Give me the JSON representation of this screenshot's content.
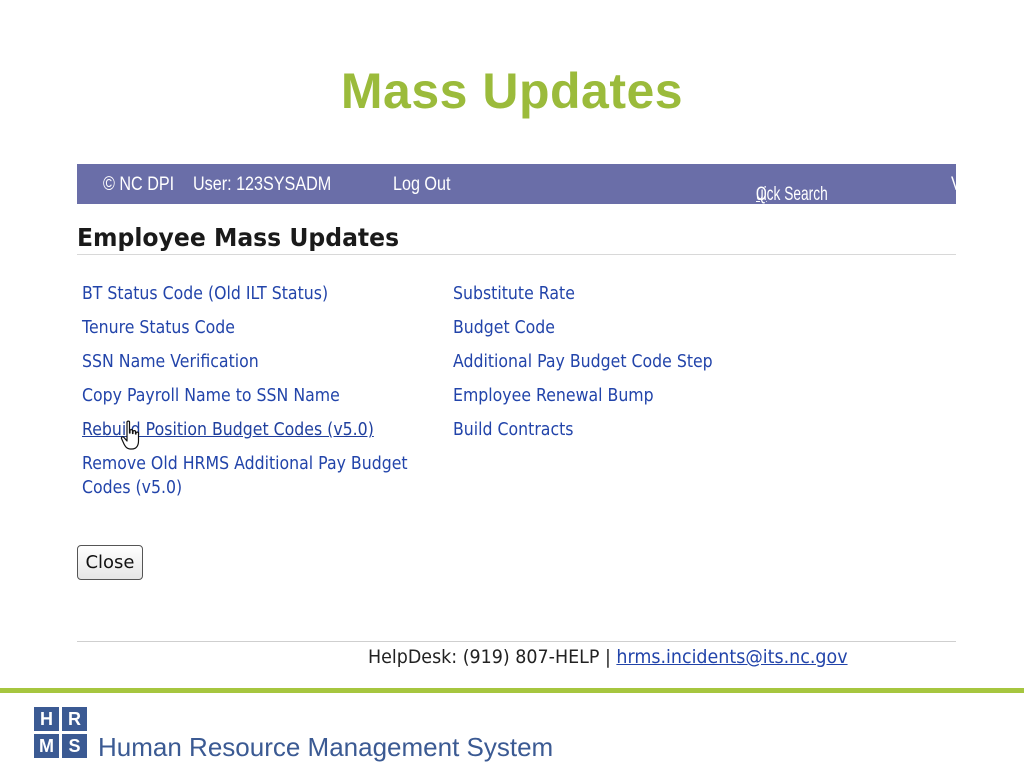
{
  "slide": {
    "title": "Mass Updates"
  },
  "topbar": {
    "copyright": "© NC DPI",
    "user": "User: 123SYSADM",
    "logout": "Log Out",
    "quick_search_first": "Q",
    "quick_search_rest": "uick Search",
    "edge_char": "V"
  },
  "page": {
    "heading": "Employee Mass Updates"
  },
  "links": {
    "left": [
      "BT Status Code (Old ILT Status)",
      "Tenure Status Code",
      "SSN Name Verification",
      "Copy Payroll Name to SSN Name",
      "Rebuild Position Budget Codes (v5.0)",
      "Remove Old HRMS Additional Pay Budget Codes (v5.0)"
    ],
    "right": [
      "Substitute Rate",
      "Budget Code",
      "Additional Pay Budget Code Step",
      "Employee Renewal Bump",
      "Build Contracts"
    ]
  },
  "buttons": {
    "close": "Close"
  },
  "footer": {
    "helpdesk": "HelpDesk: (919) 807-HELP",
    "separator": "|",
    "email": "hrms.incidents@its.nc.gov"
  },
  "brand": {
    "logo_letters": [
      "H",
      "R",
      "M",
      "S"
    ],
    "name": "Human Resource Management System"
  },
  "colors": {
    "title_green": "#9bbb3b",
    "topbar_bg": "#6a6ea8",
    "link_blue": "#2244aa",
    "brand_blue": "#3b5a93",
    "accent_line": "#a6c63f"
  },
  "icons": {
    "cursor": "hand-pointer-icon"
  }
}
